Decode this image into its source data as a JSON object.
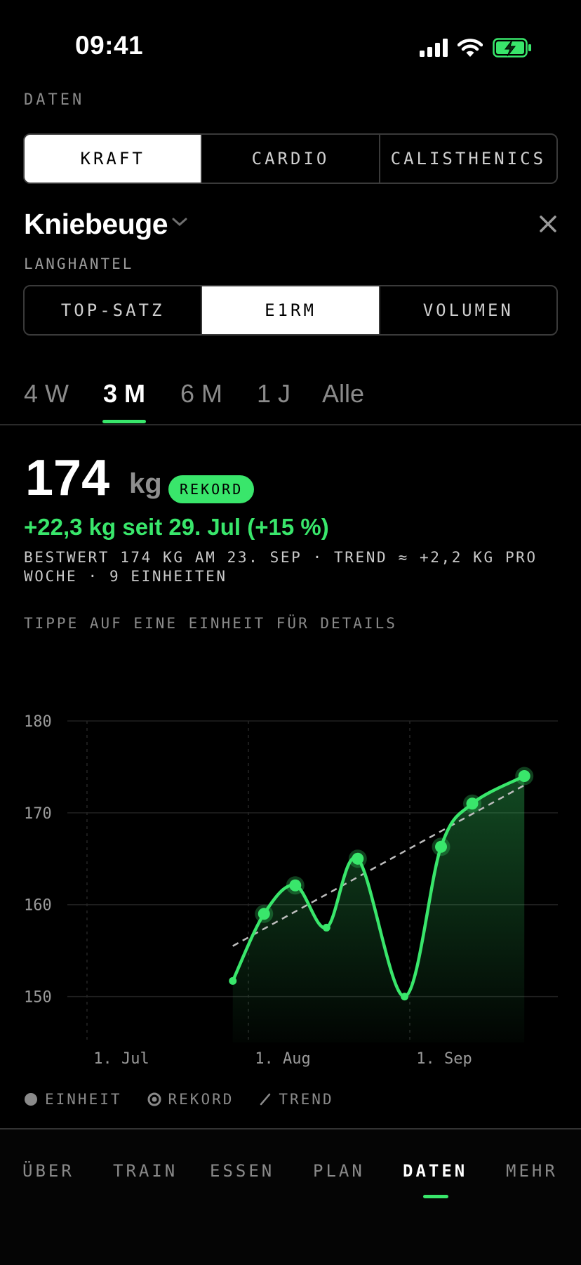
{
  "status": {
    "time": "09:41"
  },
  "section_label": "DATEN",
  "category_tabs": [
    {
      "label": "KRAFT",
      "active": true
    },
    {
      "label": "CARDIO",
      "active": false
    },
    {
      "label": "CALISTHENICS",
      "active": false
    }
  ],
  "exercise": {
    "title": "Kniebeuge",
    "equipment": "LANGHANTEL"
  },
  "metric_tabs": [
    {
      "label": "TOP-SATZ",
      "active": false
    },
    {
      "label": "E1RM",
      "active": true
    },
    {
      "label": "VOLUMEN",
      "active": false
    }
  ],
  "ranges": [
    {
      "label": "4 W",
      "active": false
    },
    {
      "label": "3 M",
      "active": true
    },
    {
      "label": "6 M",
      "active": false
    },
    {
      "label": "1 J",
      "active": false
    },
    {
      "label": "Alle",
      "active": false
    }
  ],
  "stat": {
    "value": "174",
    "unit": "kg",
    "badge": "REKORD",
    "delta": "+22,3 kg seit 29. Jul (+15 %)",
    "summary": "BESTWERT 174 KG AM 23. SEP · TREND ≈ +2,2 KG PRO WOCHE · 9 EINHEITEN",
    "hint": "TIPPE AUF EINE EINHEIT FÜR DETAILS"
  },
  "colors": {
    "accent": "#39e66b",
    "background": "#000000"
  },
  "chart_data": {
    "type": "line",
    "x_ticks": [
      "1. Jul",
      "1. Aug",
      "1. Sep"
    ],
    "y_ticks": [
      150,
      160,
      170,
      180
    ],
    "ylim": [
      145,
      180
    ],
    "series": [
      {
        "name": "EINHEIT",
        "points": [
          {
            "x": "2025-07-29",
            "y": 151.7,
            "record": false
          },
          {
            "x": "2025-08-04",
            "y": 159.0,
            "record": true
          },
          {
            "x": "2025-08-10",
            "y": 162.1,
            "record": true
          },
          {
            "x": "2025-08-16",
            "y": 157.5,
            "record": false
          },
          {
            "x": "2025-08-22",
            "y": 165.0,
            "record": true
          },
          {
            "x": "2025-08-31",
            "y": 150.0,
            "record": false
          },
          {
            "x": "2025-09-07",
            "y": 166.3,
            "record": true
          },
          {
            "x": "2025-09-13",
            "y": 171.0,
            "record": true
          },
          {
            "x": "2025-09-23",
            "y": 174.0,
            "record": true
          }
        ]
      }
    ],
    "trend": {
      "from": {
        "x": "2025-07-29",
        "y": 155.5
      },
      "to": {
        "x": "2025-09-23",
        "y": 173.0
      }
    },
    "grid": true
  },
  "legend": [
    {
      "label": "EINHEIT",
      "icon": "dot-icon"
    },
    {
      "label": "REKORD",
      "icon": "ring-dot-icon"
    },
    {
      "label": "TREND",
      "icon": "slash-icon"
    }
  ],
  "tabbar": [
    {
      "label": "ÜBER",
      "active": false
    },
    {
      "label": "TRAIN",
      "active": false
    },
    {
      "label": "ESSEN",
      "active": false
    },
    {
      "label": "PLAN",
      "active": false
    },
    {
      "label": "DATEN",
      "active": true
    },
    {
      "label": "MEHR",
      "active": false
    }
  ]
}
